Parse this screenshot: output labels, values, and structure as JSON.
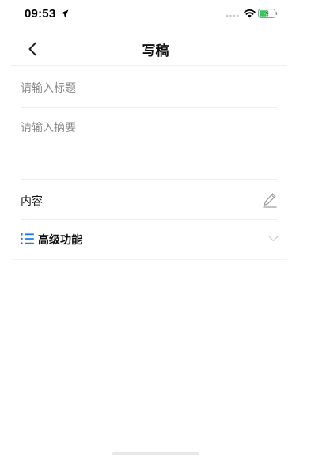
{
  "status_bar": {
    "time": "09:53",
    "icons": [
      "location-arrow-icon",
      "signal-dots-icon",
      "wifi-icon",
      "battery-charging-icon"
    ]
  },
  "nav": {
    "back_icon": "chevron-left-icon",
    "title": "写稿"
  },
  "form": {
    "title_placeholder": "请输入标题",
    "title_value": "",
    "summary_placeholder": "请输入摘要",
    "summary_value": "",
    "content_label": "内容",
    "content_icon": "pencil-edit-icon",
    "advanced_label": "高级功能",
    "advanced_icon": "list-icon",
    "advanced_chevron": "chevron-down-icon"
  },
  "colors": {
    "accent_blue": "#1b7bf0",
    "battery_green": "#34c759",
    "placeholder_gray": "#8a8a8a",
    "divider": "#efefef"
  }
}
